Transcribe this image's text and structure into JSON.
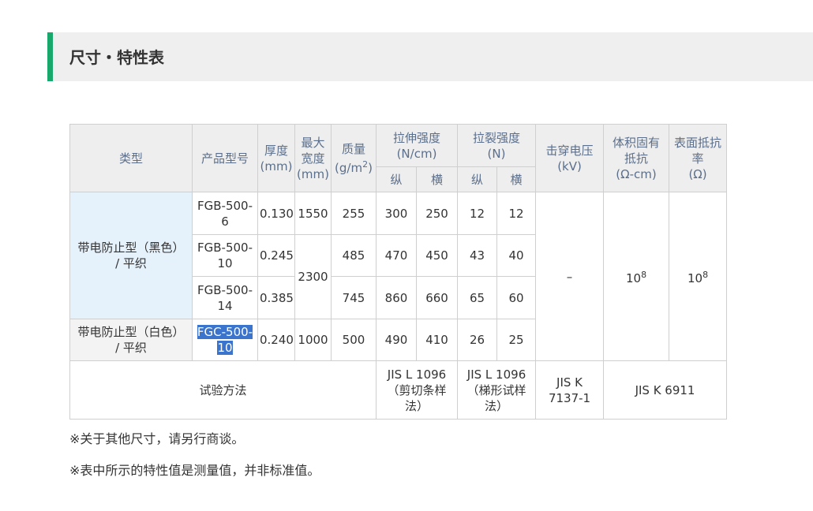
{
  "section_title": "尺寸・特性表",
  "table": {
    "headers": {
      "type": "类型",
      "model": "产品型号",
      "thickness": [
        "厚度",
        "(mm)"
      ],
      "max_width": [
        "最大",
        "宽度",
        "(mm)"
      ],
      "mass": [
        "质量",
        "(g/m",
        "2",
        ")"
      ],
      "tensile": [
        "拉伸强度",
        "(N/cm)"
      ],
      "tear": [
        "拉裂强度",
        "(N)"
      ],
      "breakdown": [
        "击穿电压",
        "(kV)"
      ],
      "volume_resistivity": [
        "体积固有",
        "抵抗",
        "(Ω-cm)"
      ],
      "surface_resistivity": [
        "表面抵抗",
        "率",
        "(Ω)"
      ],
      "longitudinal": "纵",
      "transverse": "横"
    },
    "groups": {
      "black": [
        "带电防止型（黑色）",
        "/ 平织"
      ],
      "white": [
        "带电防止型（白色）",
        "/ 平织"
      ]
    },
    "rows": [
      {
        "model": [
          "FGB-500-",
          "6"
        ],
        "thickness": "0.130",
        "width": "1550",
        "mass": "255",
        "tensile_l": "300",
        "tensile_t": "250",
        "tear_l": "12",
        "tear_t": "12"
      },
      {
        "model": [
          "FGB-500-",
          "10"
        ],
        "thickness": "0.245",
        "width": "2300",
        "mass": "485",
        "tensile_l": "470",
        "tensile_t": "450",
        "tear_l": "43",
        "tear_t": "40"
      },
      {
        "model": [
          "FGB-500-",
          "14"
        ],
        "thickness": "0.385",
        "mass": "745",
        "tensile_l": "860",
        "tensile_t": "660",
        "tear_l": "65",
        "tear_t": "60"
      },
      {
        "model": [
          "FGC-500-",
          "10"
        ],
        "thickness": "0.240",
        "width": "1000",
        "mass": "500",
        "tensile_l": "490",
        "tensile_t": "410",
        "tear_l": "26",
        "tear_t": "25"
      }
    ],
    "shared": {
      "breakdown": "–",
      "volume_base": "10",
      "volume_exp": "8",
      "surface_base": "10",
      "surface_exp": "8"
    },
    "test_method": {
      "label": "试验方法",
      "tensile": [
        "JIS L 1096",
        "（剪切条样",
        "法）"
      ],
      "tear": [
        "JIS L 1096",
        "（梯形试样",
        "法）"
      ],
      "breakdown": [
        "JIS K",
        "7137-1"
      ],
      "resistivity": "JIS K 6911"
    }
  },
  "notes": [
    "※关于其他尺寸，请另行商谈。",
    "※表中所示的特性值是测量值，并非标准值。"
  ]
}
